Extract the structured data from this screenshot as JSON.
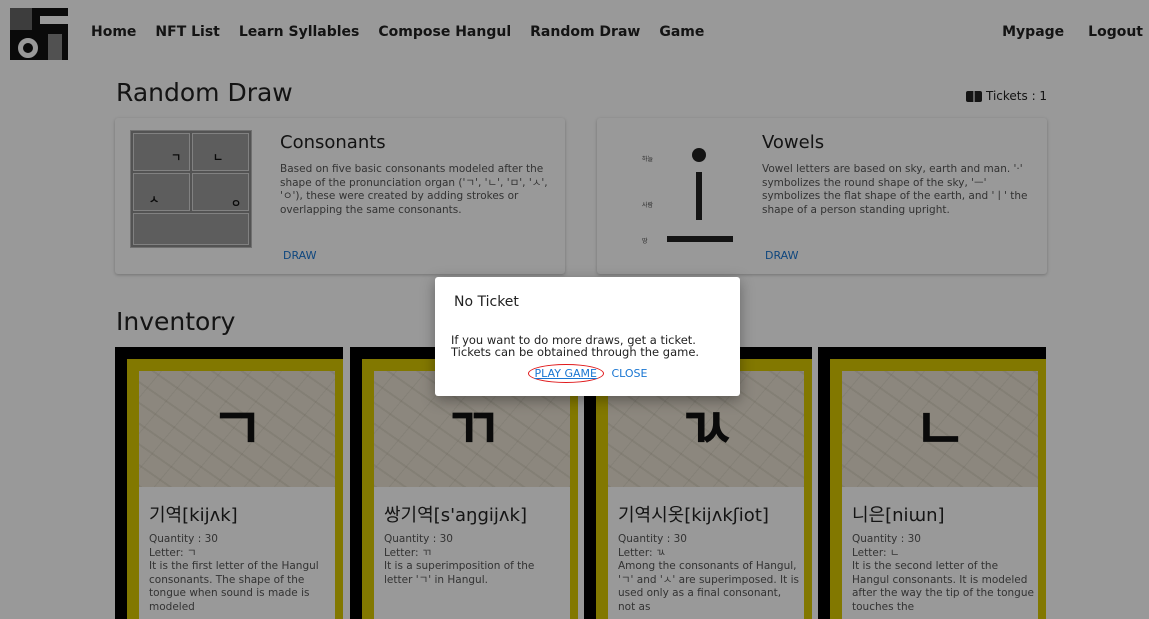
{
  "nav": {
    "links": [
      "Home",
      "NFT List",
      "Learn Syllables",
      "Compose Hangul",
      "Random Draw",
      "Game"
    ],
    "right": [
      "Mypage",
      "Logout"
    ]
  },
  "random_draw": {
    "title": "Random Draw",
    "tickets": "Tickets : 1",
    "consonants": {
      "title": "Consonants",
      "description": "Based on five basic consonants modeled after the shape of the pronunciation organ ('ㄱ', 'ㄴ', 'ㅁ', 'ㅅ', 'ㅇ'), these were created by adding strokes or overlapping the same consonants.",
      "button": "DRAW",
      "image_glyphs": [
        "ㄱ",
        "ㄴ",
        "ㅅ",
        "ㅇ"
      ]
    },
    "vowels": {
      "title": "Vowels",
      "description": "Vowel letters are based on sky, earth and man. '·' symbolizes the round shape of the sky, 'ㅡ' symbolizes the flat shape of the earth, and 'ㅣ' the shape of a person standing upright.",
      "button": "DRAW",
      "image_labels": [
        "하늘",
        "사람",
        "땅"
      ]
    }
  },
  "inventory": {
    "title": "Inventory",
    "cards": [
      {
        "glyph": "ㄱ",
        "name": "기역[kijʌk]",
        "quantity": "Quantity : 30",
        "letter": "Letter: ㄱ",
        "description": "It is the first letter of the Hangul consonants. The shape of the tongue when sound is made is modeled"
      },
      {
        "glyph": "ㄲ",
        "name": "쌍기역[s'aŋgijʌk]",
        "quantity": "Quantity : 30",
        "letter": "Letter: ㄲ",
        "description": "It is a superimposition of the letter 'ㄱ' in Hangul."
      },
      {
        "glyph": "ㄳ",
        "name": "기역시옷[kijʌkʃiot]",
        "quantity": "Quantity : 30",
        "letter": "Letter: ㄳ",
        "description": "Among the consonants of Hangul, 'ㄱ' and 'ㅅ' are superimposed. It is used only as a final consonant, not as"
      },
      {
        "glyph": "ㄴ",
        "name": "니은[niɯn]",
        "quantity": "Quantity : 30",
        "letter": "Letter: ㄴ",
        "description": "It is the second letter of the Hangul consonants. It is modeled after the way the tip of the tongue touches the"
      }
    ]
  },
  "modal": {
    "title": "No Ticket",
    "line1": "If you want to do more draws, get a ticket.",
    "line2": "Tickets can be obtained through the game.",
    "play_button": "PLAY GAME",
    "close_button": "CLOSE"
  },
  "colors": {
    "accent": "#1976d2",
    "card_frame": "#d9c800",
    "highlight_circle": "#e0191b"
  }
}
